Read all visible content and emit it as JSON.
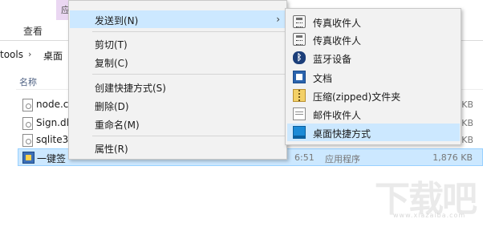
{
  "explorer": {
    "ribbon": {
      "manage_tab_label": "应",
      "view_tab_label": "查看"
    },
    "address": {
      "segments": [
        "tools",
        "桌面"
      ],
      "separator": "›"
    },
    "columns": {
      "name_header": "名称"
    },
    "files": [
      {
        "name": "node.c",
        "time": "",
        "type": "",
        "size": "KB"
      },
      {
        "name": "Sign.dl",
        "time": "",
        "type": "",
        "size": "KB"
      },
      {
        "name": "sqlite3",
        "time": "",
        "type": "",
        "size": "KB"
      },
      {
        "name": "一键签",
        "time": "6:51",
        "type": "应用程序",
        "size": "1,876 KB"
      }
    ]
  },
  "context_menu": {
    "items": [
      {
        "label": "发送到(N)",
        "has_submenu": true,
        "arrow": "›"
      },
      {
        "label": "剪切(T)"
      },
      {
        "label": "复制(C)"
      },
      {
        "label": "创建快捷方式(S)"
      },
      {
        "label": "删除(D)"
      },
      {
        "label": "重命名(M)"
      },
      {
        "label": "属性(R)"
      }
    ]
  },
  "send_to_menu": {
    "items": [
      {
        "label": "传真收件人",
        "icon": "fax-icon"
      },
      {
        "label": "传真收件人",
        "icon": "fax-icon"
      },
      {
        "label": "蓝牙设备",
        "icon": "bluetooth-icon"
      },
      {
        "label": "文档",
        "icon": "documents-icon"
      },
      {
        "label": "压缩(zipped)文件夹",
        "icon": "zip-folder-icon"
      },
      {
        "label": "邮件收件人",
        "icon": "mail-icon"
      },
      {
        "label": "桌面快捷方式",
        "icon": "desktop-icon"
      }
    ],
    "bluetooth_glyph": "ᛒ"
  },
  "watermark": {
    "glyphs": [
      "下",
      "载",
      "吧"
    ],
    "url": "www.xiazaiba.com"
  },
  "colors": {
    "highlight": "#cce8ff",
    "menu_background": "#f2f2f2",
    "manage_tab": "#ead7f2"
  }
}
